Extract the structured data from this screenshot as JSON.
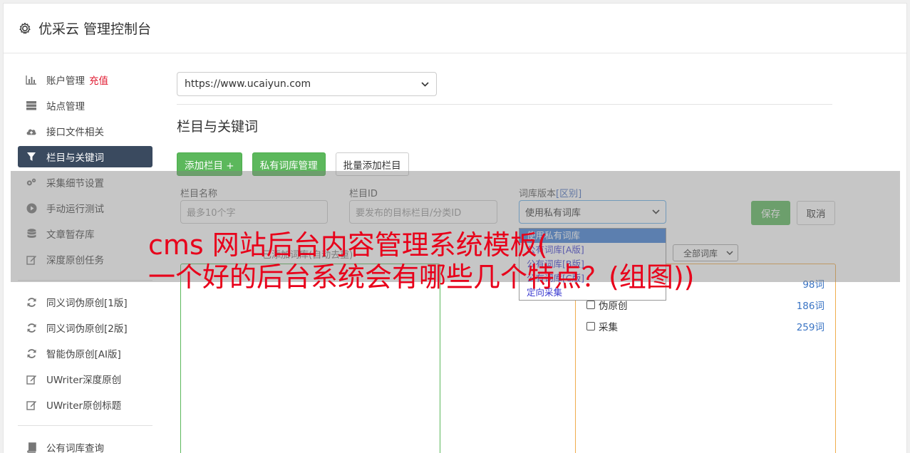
{
  "app": {
    "title": "优采云 管理控制台"
  },
  "sidebar": {
    "items": [
      {
        "icon": "bar-chart-icon",
        "label": "账户管理",
        "badge": "充值"
      },
      {
        "icon": "server-icon",
        "label": "站点管理"
      },
      {
        "icon": "cloud-upload-icon",
        "label": "接口文件相关"
      },
      {
        "icon": "filter-icon",
        "label": "栏目与关键词",
        "active": true
      },
      {
        "icon": "gears-icon",
        "label": "采集细节设置"
      },
      {
        "icon": "play-circle-icon",
        "label": "手动运行测试"
      },
      {
        "icon": "database-icon",
        "label": "文章暂存库"
      },
      {
        "icon": "edit-icon",
        "label": "深度原创任务"
      },
      {
        "icon": "refresh-icon",
        "label": "同义词伪原创[1版]"
      },
      {
        "icon": "refresh-icon",
        "label": "同义词伪原创[2版]"
      },
      {
        "icon": "refresh-icon",
        "label": "智能伪原创[AI版]"
      },
      {
        "icon": "edit-icon",
        "label": "UWriter深度原创"
      },
      {
        "icon": "edit-icon",
        "label": "UWriter原创标题"
      },
      {
        "icon": "book-icon",
        "label": "公有词库查询"
      }
    ]
  },
  "main": {
    "site_select": "https://www.ucaiyun.com",
    "section_title": "栏目与关键词",
    "buttons": {
      "add_column": "添加栏目 +",
      "private_lib": "私有词库管理",
      "batch_add": "批量添加栏目"
    },
    "form": {
      "name_label": "栏目名称",
      "name_placeholder": "最多10个字",
      "id_label": "栏目ID",
      "id_placeholder": "要发布的目标栏目/分类ID",
      "version_label": "词库版本",
      "version_label_hint": "[区别]",
      "version_value": "使用私有词库",
      "save": "保存",
      "cancel": "取消"
    },
    "dropdown_options": [
      "使用私有词库",
      "公有词库[A版]",
      "公有词库[B版]",
      "公有词库[C版]",
      "定向采集"
    ],
    "below_label": "已添加词库(自动去重)",
    "lib_filter": "全部词库",
    "libraries": [
      {
        "name": "",
        "count": "98词"
      },
      {
        "name": "伪原创",
        "count": "186词"
      },
      {
        "name": "采集",
        "count": "259词"
      }
    ]
  },
  "watermark": {
    "line1": "cms 网站后台内容管理系统模板(",
    "line2": "一个好的后台系统会有哪些几个特点？(组图))"
  }
}
